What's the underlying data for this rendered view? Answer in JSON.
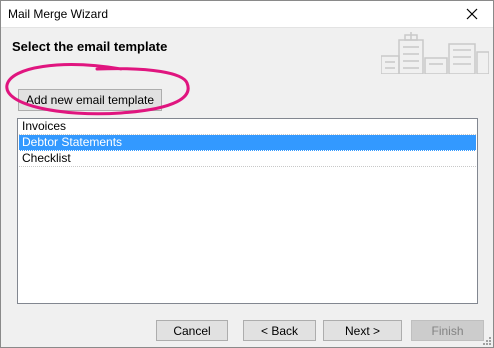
{
  "window": {
    "title": "Mail Merge Wizard"
  },
  "header": {
    "title": "Select the email template"
  },
  "toolbar": {
    "add_label": "Add new email template"
  },
  "templates": {
    "items": [
      {
        "label": "Invoices",
        "selected": false
      },
      {
        "label": "Debtor Statements",
        "selected": true
      },
      {
        "label": "Checklist",
        "selected": false
      }
    ]
  },
  "footer": {
    "cancel_label": "Cancel",
    "back_label": "< Back",
    "next_label": "Next >",
    "finish_label": "Finish"
  },
  "colors": {
    "selection": "#3399ff",
    "annotation": "#e0157f"
  }
}
